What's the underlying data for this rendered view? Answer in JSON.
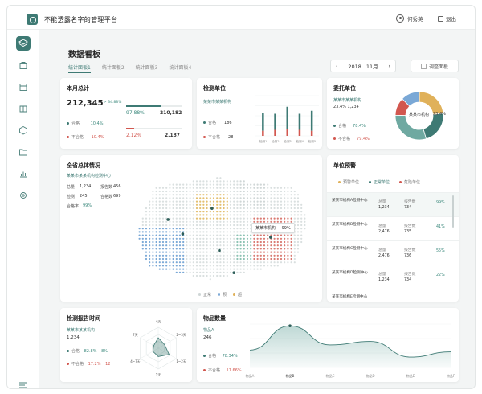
{
  "app": {
    "title": "不能透露名字的管理平台",
    "user": "何秀英",
    "logout": "退出"
  },
  "page": {
    "title": "数据看板",
    "tabs": [
      "统计面板1",
      "统计面板2",
      "统计面板3",
      "统计面板4"
    ],
    "date": {
      "year": "2018",
      "month": "11月",
      "prev": "‹",
      "next": "›"
    },
    "adjust_button": "调整面板"
  },
  "monthly": {
    "title": "本月总计",
    "total": "212,345",
    "change": "↗ 34.88%",
    "pct_good": "97.88%",
    "count_good": "210,182",
    "pct_bad": "2.12%",
    "count_bad": "2,187",
    "label_good": "合格",
    "label_good_pct": "10.4%",
    "label_bad": "不合格",
    "label_bad_pct": "10.4%",
    "good_fraction": 0.62,
    "bad_fraction": 0.14
  },
  "unit": {
    "title": "检测单位",
    "name": "某某市某某机构",
    "pass_label": "合格",
    "pass_val": "186",
    "fail_label": "不合格",
    "fail_val": "28",
    "x_labels": [
      "检测1",
      "检测2",
      "检测3",
      "检测4",
      "检测5"
    ]
  },
  "entrust": {
    "title": "委托单位",
    "name": "某某市某某机构",
    "pct": "23.4%",
    "pct2": "1,234",
    "label_a": "合格",
    "val_a": "78.4%",
    "label_b": "不合格",
    "val_b": "79.4%",
    "slice_label": "某某市机构",
    "slice_pct": "23.4%"
  },
  "province": {
    "title": "全省总体情况",
    "org": "某某市某某机构检测中心",
    "stats": [
      {
        "k": "总量",
        "v": "1,234",
        "k2": "报告数",
        "v2": "456"
      },
      {
        "k": "检测",
        "v": "245",
        "k2": "合格数",
        "v2": "699"
      },
      {
        "k": "合格率",
        "v": "99%"
      }
    ],
    "tooltip_name": "某某市机构",
    "tooltip_val": "99%",
    "legend": [
      "正常",
      "预",
      "超"
    ]
  },
  "warning": {
    "title": "单位预警",
    "legend": [
      "预警单位",
      "正常单位",
      "危险单位"
    ],
    "rows": [
      {
        "name": "某某市机构A检测中心",
        "k1": "总量",
        "v1": "1,234",
        "k2": "报告数",
        "v2": "734",
        "pct": "99%"
      },
      {
        "name": "某某市机构B检测中心",
        "k1": "总量",
        "v1": "2,476",
        "k2": "报告数",
        "v2": "735",
        "pct": "41%"
      },
      {
        "name": "某某市机构C检测中心",
        "k1": "总量",
        "v1": "2,476",
        "k2": "报告数",
        "v2": "736",
        "pct": "55%"
      },
      {
        "name": "某某市机构D检测中心",
        "k1": "总量",
        "v1": "1,234",
        "k2": "报告数",
        "v2": "734",
        "pct": "22%"
      },
      {
        "name": "某某市机构E检测中心",
        "k1": "",
        "v1": "",
        "k2": "",
        "v2": "",
        "pct": ""
      }
    ]
  },
  "report_time": {
    "title": "检测报告时间",
    "name": "某某市某某机构",
    "count": "1,234",
    "pass_label": "合格",
    "pass_pct": "82.8%",
    "pass_val": "8%",
    "fail_label": "不合格",
    "fail_pct": "17.2%",
    "fail_val": "12",
    "radar_labels": [
      "4天",
      "2~3天",
      "1~2天",
      "1天",
      "4~7天",
      "7天"
    ]
  },
  "goods": {
    "title": "物品数量",
    "item": "物品A",
    "count": "246",
    "pass_label": "合格",
    "pass_pct": "78.34%",
    "fail_label": "不合格",
    "fail_pct": "11.66%",
    "x_labels": [
      "物品A",
      "物品B",
      "物品C",
      "物品D",
      "物品E",
      "物品F"
    ]
  },
  "chart_data": [
    {
      "type": "bar",
      "categories": [
        "检测1",
        "检测2",
        "检测3",
        "检测4",
        "检测5"
      ],
      "series": [
        {
          "name": "合格",
          "values": [
            18,
            16,
            22,
            16,
            20
          ]
        },
        {
          "name": "不合格",
          "values": [
            10,
            12,
            14,
            12,
            10
          ]
        }
      ],
      "ylim": [
        0,
        40
      ]
    },
    {
      "type": "pie",
      "categories": [
        "a",
        "b",
        "c",
        "d",
        "e"
      ],
      "values": [
        23.4,
        22,
        30,
        12,
        12.6
      ]
    },
    {
      "type": "area",
      "categories": [
        "物品A",
        "物品B",
        "物品C",
        "物品D",
        "物品E",
        "物品F"
      ],
      "values": [
        20,
        48,
        26,
        30,
        12,
        18
      ]
    }
  ]
}
